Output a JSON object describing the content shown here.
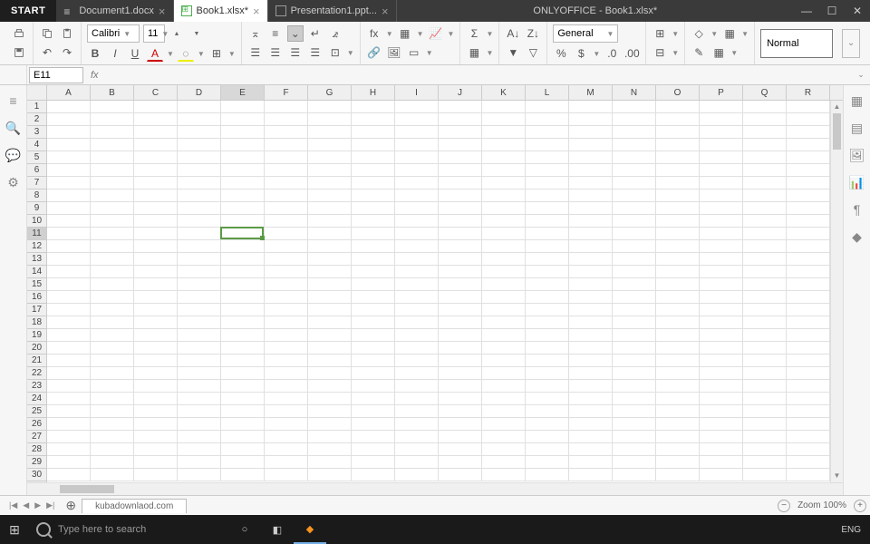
{
  "titlebar": {
    "start": "START",
    "tabs": [
      {
        "label": "Document1.docx",
        "type": "doc"
      },
      {
        "label": "Book1.xlsx*",
        "type": "xls",
        "active": true
      },
      {
        "label": "Presentation1.ppt...",
        "type": "ppt"
      }
    ],
    "app_title": "ONLYOFFICE - Book1.xlsx*"
  },
  "toolbar": {
    "font_name": "Calibri",
    "font_size": "11",
    "number_format": "General",
    "style": "Normal"
  },
  "formula_bar": {
    "name_box": "E11",
    "fx": "fx",
    "value": ""
  },
  "grid": {
    "cols": [
      "A",
      "B",
      "C",
      "D",
      "E",
      "F",
      "G",
      "H",
      "I",
      "J",
      "K",
      "L",
      "M",
      "N",
      "O",
      "P",
      "Q",
      "R"
    ],
    "rows": 30,
    "selected_col": "E",
    "selected_row": 11
  },
  "statusbar": {
    "sheet": "kubadownlaod.com",
    "zoom": "Zoom 100%",
    "lang": "ENG"
  },
  "taskbar": {
    "search_placeholder": "Type here to search",
    "lang": "ENG"
  }
}
